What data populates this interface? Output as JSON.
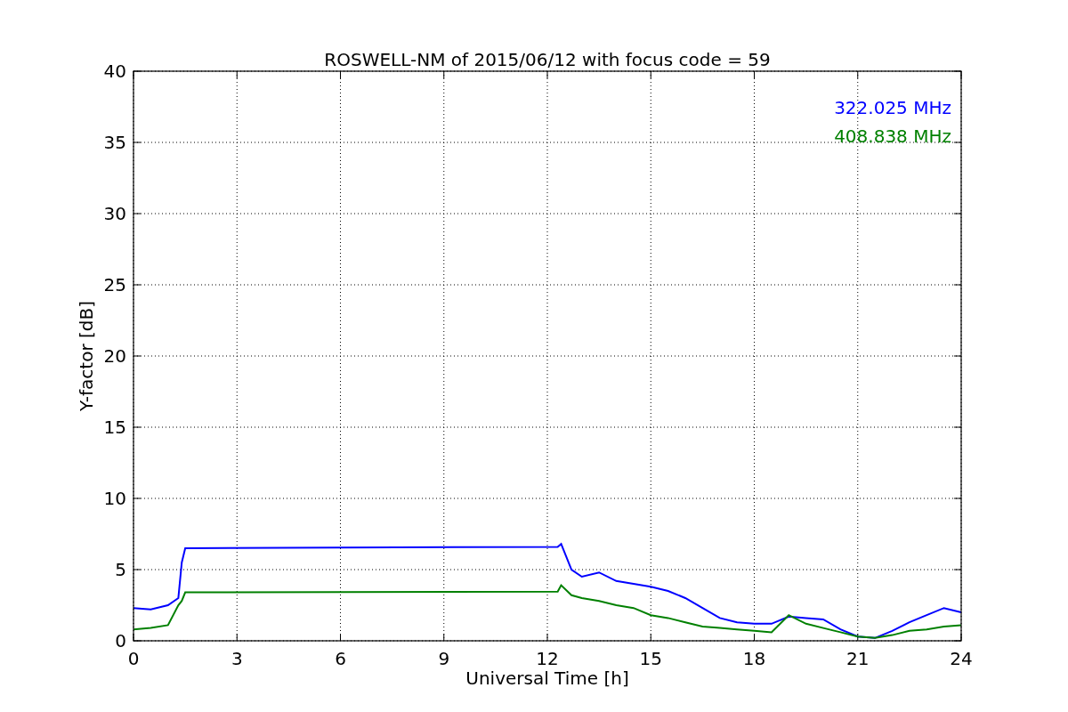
{
  "chart_data": {
    "type": "line",
    "title": "ROSWELL-NM of 2015/06/12 with focus code = 59",
    "xlabel": "Universal Time [h]",
    "ylabel": "Y-factor [dB]",
    "x": [
      0,
      0.5,
      1,
      1.3,
      1.4,
      1.5,
      12.3,
      12.4,
      12.7,
      13,
      13.5,
      14,
      14.5,
      15,
      15.5,
      16,
      16.5,
      17,
      17.5,
      18,
      18.5,
      19,
      19.5,
      20,
      20.5,
      21,
      21.5,
      22,
      22.5,
      23,
      23.5,
      24
    ],
    "series": [
      {
        "name": "322.025 MHz",
        "color": "#0000ff",
        "values": [
          2.3,
          2.2,
          2.5,
          3,
          5.5,
          6.5,
          6.6,
          6.8,
          5,
          4.5,
          4.8,
          4.2,
          4,
          3.8,
          3.5,
          3,
          2.3,
          1.6,
          1.3,
          1.2,
          1.2,
          1.7,
          1.6,
          1.5,
          0.8,
          0.3,
          0.2,
          0.7,
          1.3,
          1.8,
          2.3,
          2
        ]
      },
      {
        "name": "408.838 MHz",
        "color": "#008000",
        "values": [
          0.8,
          0.9,
          1.1,
          2.5,
          2.8,
          3.4,
          3.45,
          3.9,
          3.2,
          3,
          2.8,
          2.5,
          2.3,
          1.8,
          1.6,
          1.3,
          1,
          0.9,
          0.8,
          0.7,
          0.6,
          1.8,
          1.2,
          0.9,
          0.6,
          0.3,
          0.2,
          0.4,
          0.7,
          0.8,
          1,
          1.1
        ]
      }
    ],
    "xlim": [
      0,
      24
    ],
    "ylim": [
      0,
      40
    ],
    "xticks": [
      0,
      3,
      6,
      9,
      12,
      15,
      18,
      21,
      24
    ],
    "yticks": [
      0,
      5,
      10,
      15,
      20,
      25,
      30,
      35,
      40
    ],
    "grid": true
  }
}
